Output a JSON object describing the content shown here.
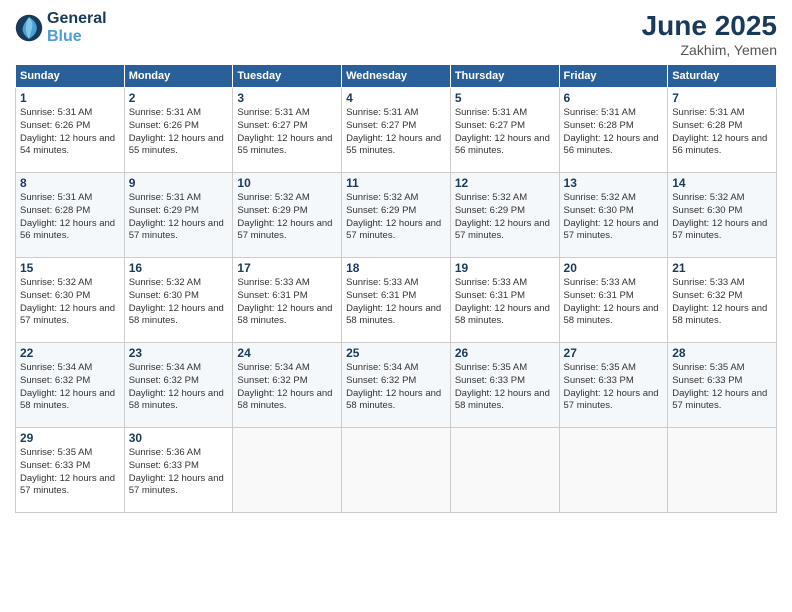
{
  "header": {
    "logo_line1": "General",
    "logo_line2": "Blue",
    "title": "June 2025",
    "subtitle": "Zakhim, Yemen"
  },
  "days_of_week": [
    "Sunday",
    "Monday",
    "Tuesday",
    "Wednesday",
    "Thursday",
    "Friday",
    "Saturday"
  ],
  "weeks": [
    [
      {
        "day": "1",
        "sunrise": "Sunrise: 5:31 AM",
        "sunset": "Sunset: 6:26 PM",
        "daylight": "Daylight: 12 hours and 54 minutes."
      },
      {
        "day": "2",
        "sunrise": "Sunrise: 5:31 AM",
        "sunset": "Sunset: 6:26 PM",
        "daylight": "Daylight: 12 hours and 55 minutes."
      },
      {
        "day": "3",
        "sunrise": "Sunrise: 5:31 AM",
        "sunset": "Sunset: 6:27 PM",
        "daylight": "Daylight: 12 hours and 55 minutes."
      },
      {
        "day": "4",
        "sunrise": "Sunrise: 5:31 AM",
        "sunset": "Sunset: 6:27 PM",
        "daylight": "Daylight: 12 hours and 55 minutes."
      },
      {
        "day": "5",
        "sunrise": "Sunrise: 5:31 AM",
        "sunset": "Sunset: 6:27 PM",
        "daylight": "Daylight: 12 hours and 56 minutes."
      },
      {
        "day": "6",
        "sunrise": "Sunrise: 5:31 AM",
        "sunset": "Sunset: 6:28 PM",
        "daylight": "Daylight: 12 hours and 56 minutes."
      },
      {
        "day": "7",
        "sunrise": "Sunrise: 5:31 AM",
        "sunset": "Sunset: 6:28 PM",
        "daylight": "Daylight: 12 hours and 56 minutes."
      }
    ],
    [
      {
        "day": "8",
        "sunrise": "Sunrise: 5:31 AM",
        "sunset": "Sunset: 6:28 PM",
        "daylight": "Daylight: 12 hours and 56 minutes."
      },
      {
        "day": "9",
        "sunrise": "Sunrise: 5:31 AM",
        "sunset": "Sunset: 6:29 PM",
        "daylight": "Daylight: 12 hours and 57 minutes."
      },
      {
        "day": "10",
        "sunrise": "Sunrise: 5:32 AM",
        "sunset": "Sunset: 6:29 PM",
        "daylight": "Daylight: 12 hours and 57 minutes."
      },
      {
        "day": "11",
        "sunrise": "Sunrise: 5:32 AM",
        "sunset": "Sunset: 6:29 PM",
        "daylight": "Daylight: 12 hours and 57 minutes."
      },
      {
        "day": "12",
        "sunrise": "Sunrise: 5:32 AM",
        "sunset": "Sunset: 6:29 PM",
        "daylight": "Daylight: 12 hours and 57 minutes."
      },
      {
        "day": "13",
        "sunrise": "Sunrise: 5:32 AM",
        "sunset": "Sunset: 6:30 PM",
        "daylight": "Daylight: 12 hours and 57 minutes."
      },
      {
        "day": "14",
        "sunrise": "Sunrise: 5:32 AM",
        "sunset": "Sunset: 6:30 PM",
        "daylight": "Daylight: 12 hours and 57 minutes."
      }
    ],
    [
      {
        "day": "15",
        "sunrise": "Sunrise: 5:32 AM",
        "sunset": "Sunset: 6:30 PM",
        "daylight": "Daylight: 12 hours and 57 minutes."
      },
      {
        "day": "16",
        "sunrise": "Sunrise: 5:32 AM",
        "sunset": "Sunset: 6:30 PM",
        "daylight": "Daylight: 12 hours and 58 minutes."
      },
      {
        "day": "17",
        "sunrise": "Sunrise: 5:33 AM",
        "sunset": "Sunset: 6:31 PM",
        "daylight": "Daylight: 12 hours and 58 minutes."
      },
      {
        "day": "18",
        "sunrise": "Sunrise: 5:33 AM",
        "sunset": "Sunset: 6:31 PM",
        "daylight": "Daylight: 12 hours and 58 minutes."
      },
      {
        "day": "19",
        "sunrise": "Sunrise: 5:33 AM",
        "sunset": "Sunset: 6:31 PM",
        "daylight": "Daylight: 12 hours and 58 minutes."
      },
      {
        "day": "20",
        "sunrise": "Sunrise: 5:33 AM",
        "sunset": "Sunset: 6:31 PM",
        "daylight": "Daylight: 12 hours and 58 minutes."
      },
      {
        "day": "21",
        "sunrise": "Sunrise: 5:33 AM",
        "sunset": "Sunset: 6:32 PM",
        "daylight": "Daylight: 12 hours and 58 minutes."
      }
    ],
    [
      {
        "day": "22",
        "sunrise": "Sunrise: 5:34 AM",
        "sunset": "Sunset: 6:32 PM",
        "daylight": "Daylight: 12 hours and 58 minutes."
      },
      {
        "day": "23",
        "sunrise": "Sunrise: 5:34 AM",
        "sunset": "Sunset: 6:32 PM",
        "daylight": "Daylight: 12 hours and 58 minutes."
      },
      {
        "day": "24",
        "sunrise": "Sunrise: 5:34 AM",
        "sunset": "Sunset: 6:32 PM",
        "daylight": "Daylight: 12 hours and 58 minutes."
      },
      {
        "day": "25",
        "sunrise": "Sunrise: 5:34 AM",
        "sunset": "Sunset: 6:32 PM",
        "daylight": "Daylight: 12 hours and 58 minutes."
      },
      {
        "day": "26",
        "sunrise": "Sunrise: 5:35 AM",
        "sunset": "Sunset: 6:33 PM",
        "daylight": "Daylight: 12 hours and 58 minutes."
      },
      {
        "day": "27",
        "sunrise": "Sunrise: 5:35 AM",
        "sunset": "Sunset: 6:33 PM",
        "daylight": "Daylight: 12 hours and 57 minutes."
      },
      {
        "day": "28",
        "sunrise": "Sunrise: 5:35 AM",
        "sunset": "Sunset: 6:33 PM",
        "daylight": "Daylight: 12 hours and 57 minutes."
      }
    ],
    [
      {
        "day": "29",
        "sunrise": "Sunrise: 5:35 AM",
        "sunset": "Sunset: 6:33 PM",
        "daylight": "Daylight: 12 hours and 57 minutes."
      },
      {
        "day": "30",
        "sunrise": "Sunrise: 5:36 AM",
        "sunset": "Sunset: 6:33 PM",
        "daylight": "Daylight: 12 hours and 57 minutes."
      },
      {
        "day": "",
        "sunrise": "",
        "sunset": "",
        "daylight": ""
      },
      {
        "day": "",
        "sunrise": "",
        "sunset": "",
        "daylight": ""
      },
      {
        "day": "",
        "sunrise": "",
        "sunset": "",
        "daylight": ""
      },
      {
        "day": "",
        "sunrise": "",
        "sunset": "",
        "daylight": ""
      },
      {
        "day": "",
        "sunrise": "",
        "sunset": "",
        "daylight": ""
      }
    ]
  ]
}
